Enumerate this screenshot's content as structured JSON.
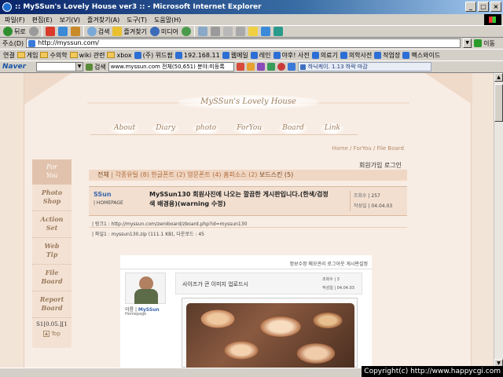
{
  "window": {
    "title": ":: MySSun's Lovely House ver3 :: - Microsoft Internet Explorer",
    "controls": [
      "_",
      "□",
      "×"
    ]
  },
  "menu": [
    "파일(F)",
    "편집(E)",
    "보기(V)",
    "즐겨찾기(A)",
    "도구(T)",
    "도움말(H)"
  ],
  "toolbar": {
    "back": "뒤로",
    "search": "검색",
    "favorites": "즐겨찾기",
    "media": "미디어"
  },
  "address": {
    "label": "주소(D)",
    "url": "http://myssun.com/",
    "go": "이동"
  },
  "links": {
    "label": "연결",
    "items": [
      "게임",
      "수의학",
      "wiki 관련",
      "xbox",
      "(주) 위드팜",
      "192.168.11",
      "웹메일",
      "레인",
      "야후! 사전",
      "의료기",
      "의학사전",
      "작업장",
      "팩스와이드"
    ]
  },
  "naver": {
    "logo": "Naver",
    "search_btn": "검색",
    "input_text": "www.myssun.com 전체(50,651) 분야:미등록",
    "ticker": "하닉케이. 1.13 하락 마감"
  },
  "site": {
    "title": "MySSun's Lovely House",
    "nav": [
      "About",
      "Diary",
      "photo",
      "ForYou",
      "Board",
      "Link"
    ],
    "breadcrumb": "Home / ForYou / File Board",
    "member_links": "회원가입 로그인"
  },
  "sidebar": {
    "head": "For\nYou",
    "items": [
      "Photo\nShop",
      "Action\nSet",
      "Web\nTip",
      "File\nBoard",
      "Report\nBoard"
    ],
    "counter": "S1[0.05.][1",
    "top_label": "Top"
  },
  "categories": {
    "all": "전체",
    "rest": "| 각종유틸 (8)  한글폰트 (2)  영문폰트 (4)  홈피소스 (2)  ",
    "skin": "보드스킨 (5)"
  },
  "post": {
    "author": "SSun",
    "homepage": "| HOMEPAGE",
    "title": "MySSun130 회원사진에 나오는 깔끔한 게시판입니다.(한색/검정색 배경용)(warning 수정)",
    "hits_label": "조회수",
    "hits": "| 257",
    "date_label": "작성일",
    "date": "| 04.04.03",
    "link": "| 링크1 : http://myssun.com/zeroboard/zboard.php?id=myssun130",
    "file": "| 파일1 : myssun130.zip (111.1 KB), 다운로드 : 45"
  },
  "inner": {
    "top_links": "정보수정  메모관리  로그아웃  게시판설정",
    "name_label": "이름 |",
    "name": "MySSun",
    "homepage": "Homepage",
    "post_title": "사이즈가 큰 이미지 업로드시",
    "hits": "조회수 | 3",
    "date": "작성일 | 04.04.03"
  },
  "copyright": "Copyright(c) http://www.happycgi.com"
}
